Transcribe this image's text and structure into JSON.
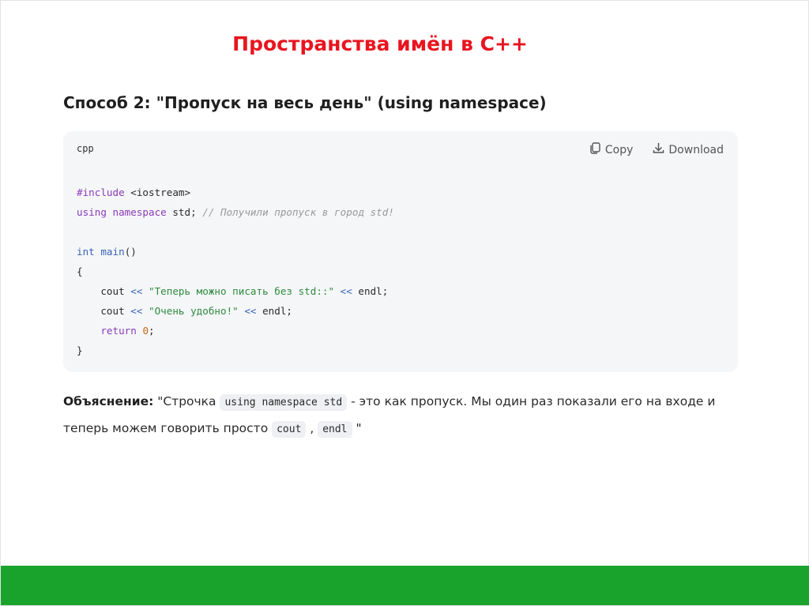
{
  "slide": {
    "title": "Пространства имён в C++",
    "heading": "Способ 2: \"Пропуск на весь день\" (using namespace)"
  },
  "code_block": {
    "language": "cpp",
    "copy_label": "Copy",
    "download_label": "Download",
    "lines": [
      "#include <iostream>",
      "using namespace std; // Получили пропуск в город std!",
      "",
      "int main()",
      "{",
      "    cout << \"Теперь можно писать без std::\" << endl;",
      "    cout << \"Очень удобно!\" << endl;",
      "    return 0;",
      "}"
    ]
  },
  "explanation": {
    "label": "Объяснение:",
    "text_1": " \"Строчка ",
    "code_1": "using namespace std",
    "text_2": " - это как пропуск. Мы один раз показали его на входе и теперь можем говорить просто ",
    "code_2": "cout",
    "text_3": " , ",
    "code_3": "endl",
    "text_4": " \""
  },
  "colors": {
    "title": "#e8151f",
    "footer_band": "#1aa32c",
    "code_background": "#f5f6f8"
  },
  "icons": [
    "copy-icon",
    "download-icon"
  ]
}
